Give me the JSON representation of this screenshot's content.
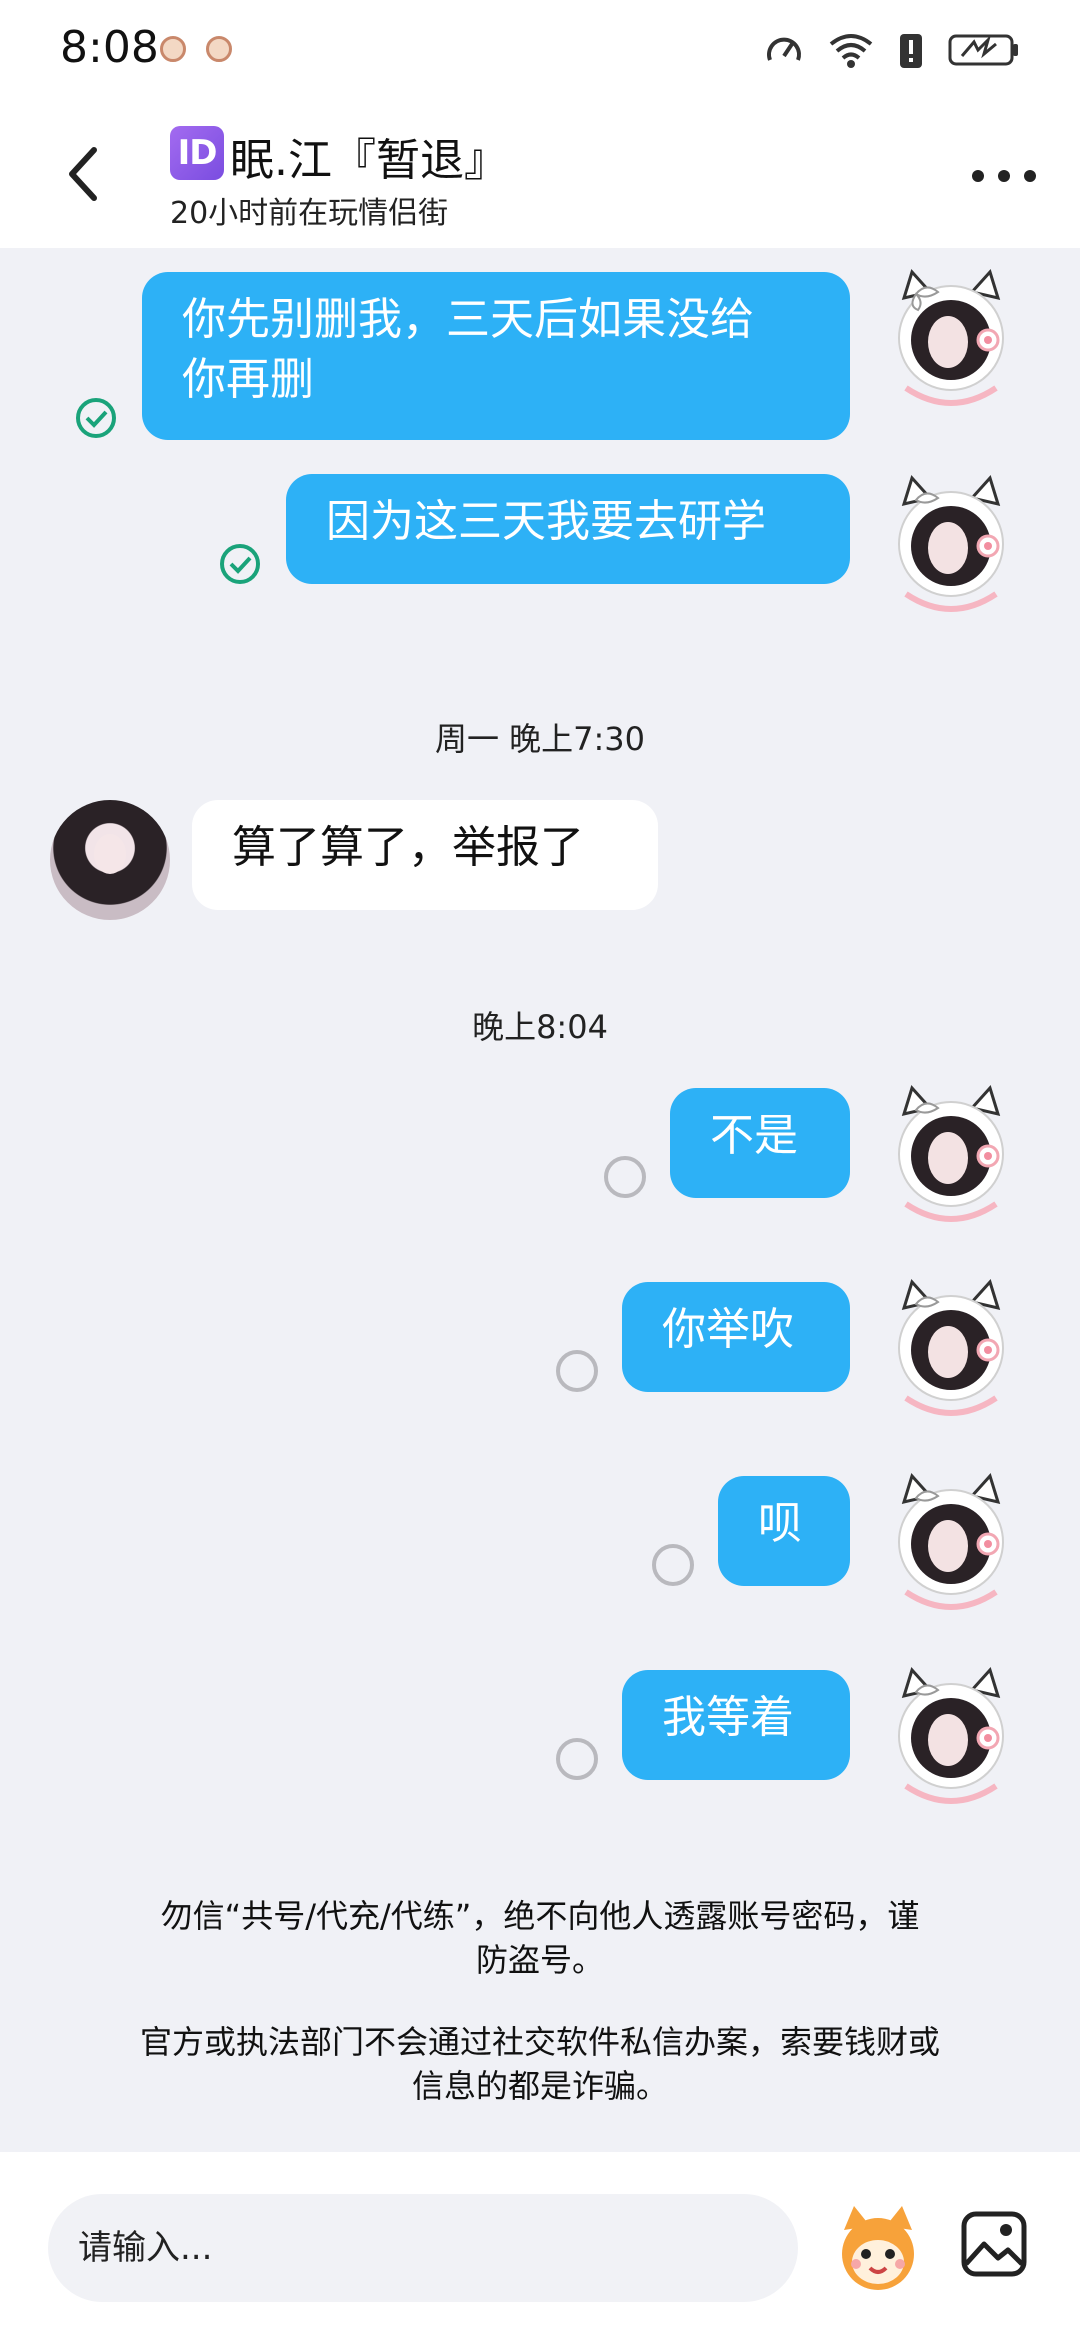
{
  "status_bar": {
    "time": "8:08",
    "icons": [
      "pig-emoji-icon",
      "pig-emoji-icon",
      "speedometer-icon",
      "wifi-icon",
      "battery-saver-alert-icon",
      "battery-icon"
    ]
  },
  "header": {
    "id_badge": "ID",
    "name": "眠.江『暂退』",
    "status": "20小时前在玩情侣街"
  },
  "messages": [
    {
      "side": "self",
      "lines": [
        "你先别删我，三天后如果没给",
        "你再删"
      ],
      "state": "read"
    },
    {
      "side": "self",
      "lines": [
        "因为这三天我要去研学"
      ],
      "state": "read"
    },
    {
      "type": "time",
      "text": "周一 晚上7:30"
    },
    {
      "side": "other",
      "lines": [
        "算了算了，举报了"
      ]
    },
    {
      "type": "time",
      "text": "晚上8:04"
    },
    {
      "side": "self",
      "lines": [
        "不是"
      ],
      "state": "unread"
    },
    {
      "side": "self",
      "lines": [
        "你举吹"
      ],
      "state": "unread"
    },
    {
      "side": "self",
      "lines": [
        "呗"
      ],
      "state": "unread"
    },
    {
      "side": "self",
      "lines": [
        "我等着"
      ],
      "state": "unread"
    }
  ],
  "notice": {
    "line1a": "勿信“共号/代充/代练”，绝不向他人透露账号密码，谨",
    "line1b": "防盗号。",
    "line2a": "官方或执法部门不会通过社交软件私信办案，索要钱财或",
    "line2b": "信息的都是诈骗。"
  },
  "input": {
    "placeholder": "请输入..."
  },
  "colors": {
    "accent": "#2db1f6",
    "background": "#f0f1f6",
    "read_check": "#1aa37a"
  }
}
